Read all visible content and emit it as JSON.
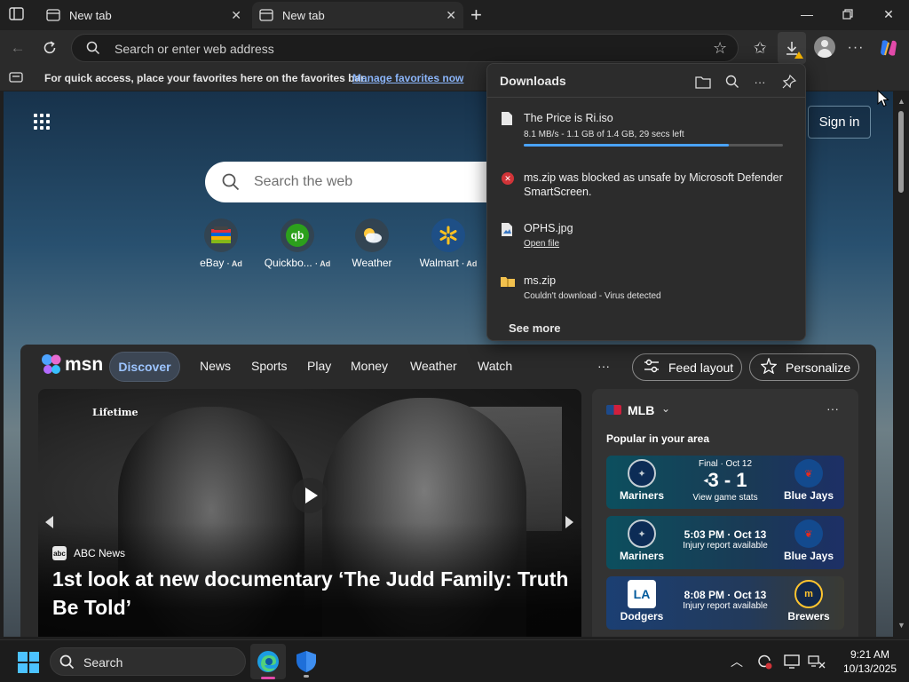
{
  "tabs": [
    {
      "title": "New tab",
      "active": false
    },
    {
      "title": "New tab",
      "active": true
    }
  ],
  "address_bar": {
    "placeholder": "Search or enter web address"
  },
  "favorites_bar": {
    "message": "For quick access, place your favorites here on the favorites bar.",
    "link": "Manage favorites now"
  },
  "newtab": {
    "sign_in": "Sign in",
    "search_placeholder": "Search the web",
    "quick_links": [
      {
        "name": "eBay",
        "ad": "· Ad",
        "icon": "ebay-icon"
      },
      {
        "name": "Quickbo...",
        "ad": "· Ad",
        "icon": "quickbooks-icon"
      },
      {
        "name": "Weather",
        "ad": "",
        "icon": "weather-icon"
      },
      {
        "name": "Walmart",
        "ad": "· Ad",
        "icon": "walmart-icon"
      }
    ]
  },
  "msn": {
    "brand": "msn",
    "nav": [
      "Discover",
      "News",
      "Sports",
      "Play",
      "Money",
      "Weather",
      "Watch"
    ],
    "more": "···",
    "feed_layout": "Feed layout",
    "personalize": "Personalize",
    "hero": {
      "channel": "Lifetime",
      "source": "ABC News",
      "headline": "1st look at new documentary ‘The Judd Family: Truth Be Told’"
    },
    "mlb": {
      "title": "MLB",
      "subtitle": "Popular in your area",
      "games": [
        {
          "home": "Mariners",
          "away": "Blue Jays",
          "status": "Final · Oct 12",
          "score": "3 - 1",
          "note": "View game stats"
        },
        {
          "home": "Mariners",
          "away": "Blue Jays",
          "status": "5:03 PM · Oct 13",
          "score": "",
          "note": "Injury report available"
        },
        {
          "home": "Dodgers",
          "away": "Brewers",
          "status": "8:08 PM · Oct 13",
          "score": "",
          "note": "Injury report available"
        }
      ]
    }
  },
  "downloads": {
    "title": "Downloads",
    "items": [
      {
        "name": "The Price is Ri.iso",
        "detail": "8.1 MB/s - 1.1 GB of 1.4 GB, 29 secs left",
        "progress": 0.79,
        "icon": "file-icon"
      },
      {
        "name": "ms.zip was blocked as unsafe by Microsoft Defender SmartScreen.",
        "detail": "",
        "icon": "blocked-icon"
      },
      {
        "name": "OPHS.jpg",
        "detail": "Open file",
        "icon": "image-file-icon"
      },
      {
        "name": "ms.zip",
        "detail": "Couldn't download - Virus detected",
        "icon": "zip-folder-icon"
      }
    ],
    "see_more": "See more"
  },
  "taskbar": {
    "search_placeholder": "Search",
    "time": "9:21 AM",
    "date": "10/13/2025"
  },
  "colors": {
    "accent_link": "#8ab4f8",
    "progress": "#4aa3ff",
    "blocked": "#d13438"
  }
}
